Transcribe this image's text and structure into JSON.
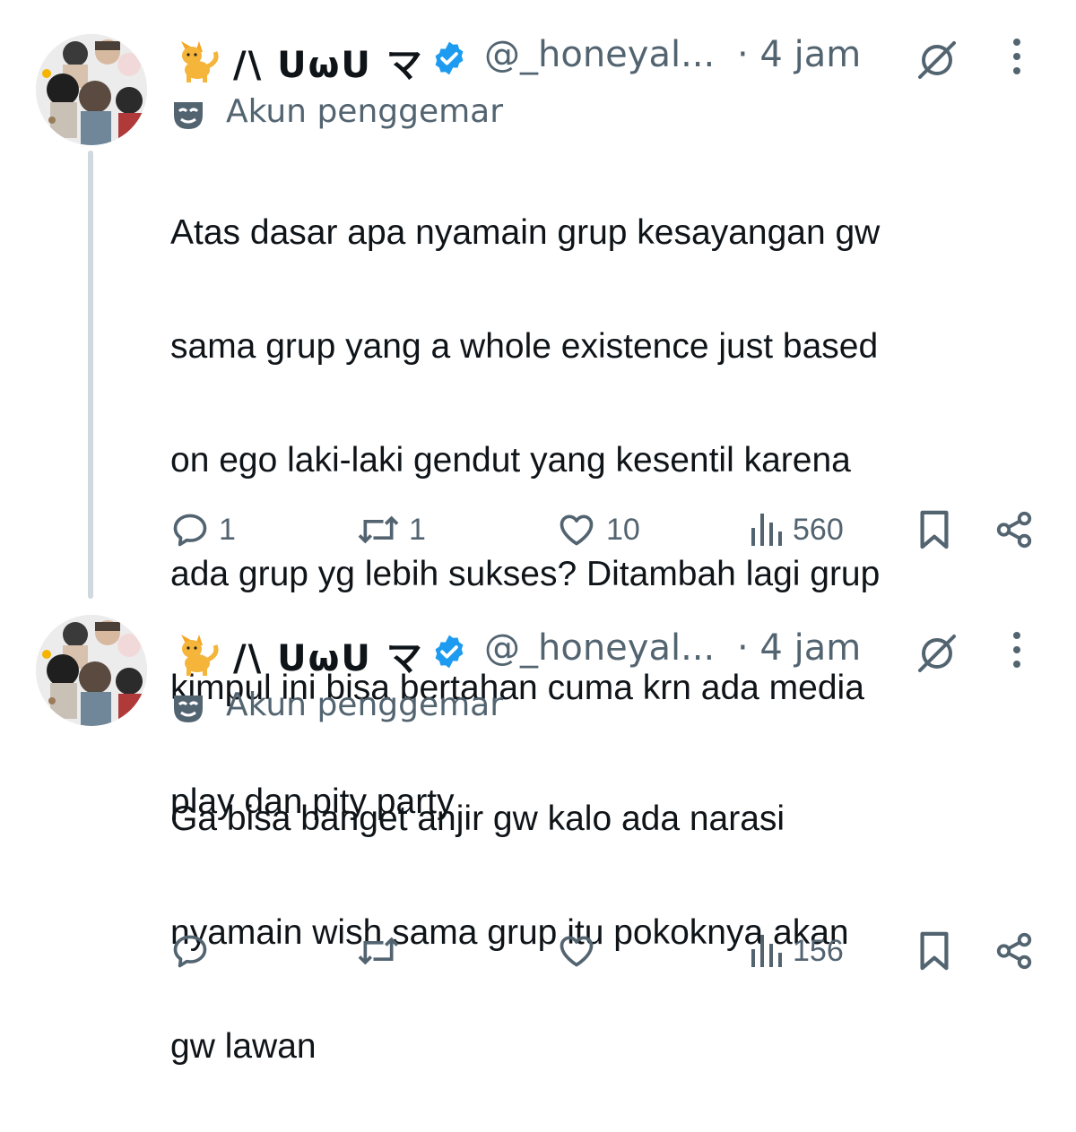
{
  "colors": {
    "verified": "#1d9bf0",
    "secondary_text": "#536471",
    "primary_text": "#0f1419",
    "thread_line": "#cfd9de"
  },
  "tweets": [
    {
      "display_name": "/\\ ᑌωᑌ マ",
      "handle": "@_honeyal...",
      "time": "· 4 jam",
      "label": "Akun penggemar",
      "text_lines": [
        "Atas dasar apa nyamain grup kesayangan gw",
        "sama grup yang a whole existence just based",
        "on ego laki-laki gendut yang kesentil karena",
        "ada grup yg lebih sukses? Ditambah lagi grup",
        "kimpul ini bisa bertahan cuma krn ada media",
        "play dan pity party"
      ],
      "replies": "1",
      "reposts": "1",
      "likes": "10",
      "views": "560"
    },
    {
      "display_name": "/\\ ᑌωᑌ マ",
      "handle": "@_honeyal...",
      "time": "· 4 jam",
      "label": "Akun penggemar",
      "text_lines": [
        "Ga bisa banget anjir gw kalo ada narasi",
        "nyamain wish sama grup itu pokoknya akan",
        "gw lawan"
      ],
      "replies": "",
      "reposts": "",
      "likes": "",
      "views": "156"
    }
  ],
  "icons": [
    "cat-emoji-icon",
    "verified-badge-icon",
    "grok-icon",
    "more-options-icon",
    "fan-account-mask-icon",
    "reply-icon",
    "repost-icon",
    "like-icon",
    "views-icon",
    "bookmark-icon",
    "share-icon"
  ]
}
